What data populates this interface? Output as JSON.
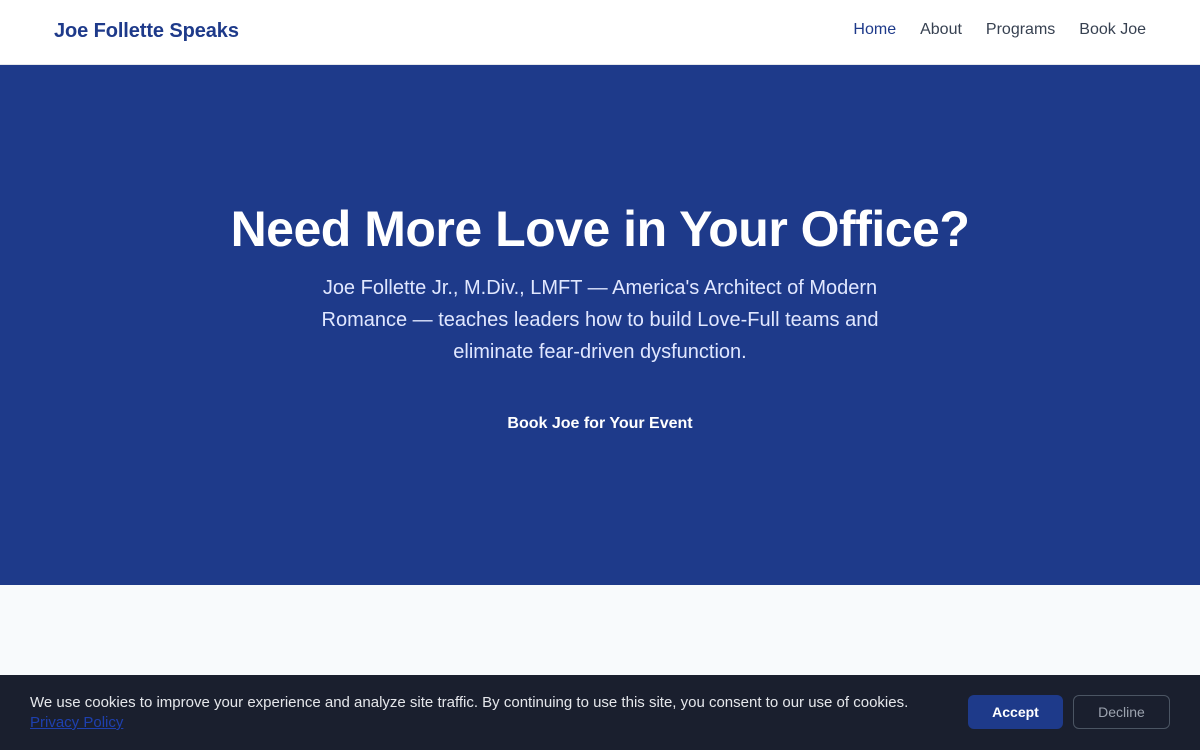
{
  "header": {
    "brand": "Joe Follette Speaks",
    "nav": [
      {
        "label": "Home"
      },
      {
        "label": "About"
      },
      {
        "label": "Programs"
      },
      {
        "label": "Book Joe"
      }
    ]
  },
  "hero": {
    "title": "Need More Love in Your Office?",
    "subtitle": "Joe Follette Jr., M.Div., LMFT — America's Architect of Modern Romance — teaches leaders how to build Love-Full teams and eliminate fear-driven dysfunction.",
    "cta_label": "Book Joe for Your Event"
  },
  "cookie": {
    "message": "We use cookies to improve your experience and analyze site traffic. By continuing to use this site, you consent to our use of cookies.",
    "privacy_link": "Privacy Policy",
    "accept_label": "Accept",
    "decline_label": "Decline"
  },
  "colors": {
    "brand": "#1e3a8a",
    "hero_bg": "#1e3a8a",
    "banner_bg": "#1a1f2e"
  }
}
